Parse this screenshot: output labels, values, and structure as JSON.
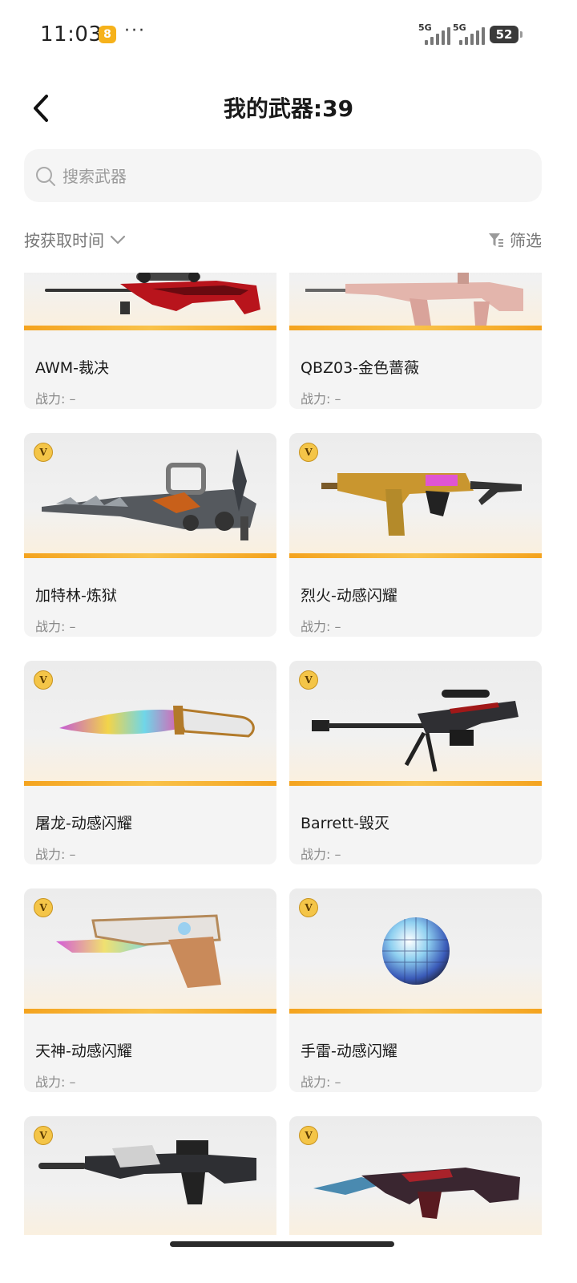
{
  "status_bar": {
    "time": "11:03",
    "app_badge": "8",
    "more": "···",
    "signal_1": "5G",
    "signal_2": "5G",
    "battery": "52"
  },
  "header": {
    "title": "我的武器:39"
  },
  "search": {
    "placeholder": "搜索武器",
    "value": ""
  },
  "toolbar": {
    "sort_label": "按获取时间",
    "filter_label": "筛选"
  },
  "weapons": [
    {
      "name": "AWM-裁决",
      "power": "战力: –",
      "vip": false,
      "icon": "sniper-rifle-icon"
    },
    {
      "name": "QBZ03-金色蔷薇",
      "power": "战力: –",
      "vip": false,
      "icon": "assault-rifle-icon"
    },
    {
      "name": "加特林-炼狱",
      "power": "战力: –",
      "vip": true,
      "icon": "gatling-gun-icon"
    },
    {
      "name": "烈火-动感闪耀",
      "power": "战力: –",
      "vip": true,
      "icon": "smg-icon"
    },
    {
      "name": "屠龙-动感闪耀",
      "power": "战力: –",
      "vip": true,
      "icon": "knife-icon"
    },
    {
      "name": "Barrett-毁灭",
      "power": "战力: –",
      "vip": true,
      "icon": "heavy-sniper-icon"
    },
    {
      "name": "天神-动感闪耀",
      "power": "战力: –",
      "vip": true,
      "icon": "pistol-icon"
    },
    {
      "name": "手雷-动感闪耀",
      "power": "战力: –",
      "vip": true,
      "icon": "disco-grenade-icon"
    },
    {
      "name": "",
      "power": "",
      "vip": true,
      "icon": "m4-rifle-icon"
    },
    {
      "name": "",
      "power": "",
      "vip": true,
      "icon": "dragon-rifle-icon"
    }
  ],
  "vip_badge": "V",
  "colors": {
    "accent": "#f4a31e",
    "card_bg": "#f4f4f4",
    "vip_gold": "#f4c548"
  }
}
